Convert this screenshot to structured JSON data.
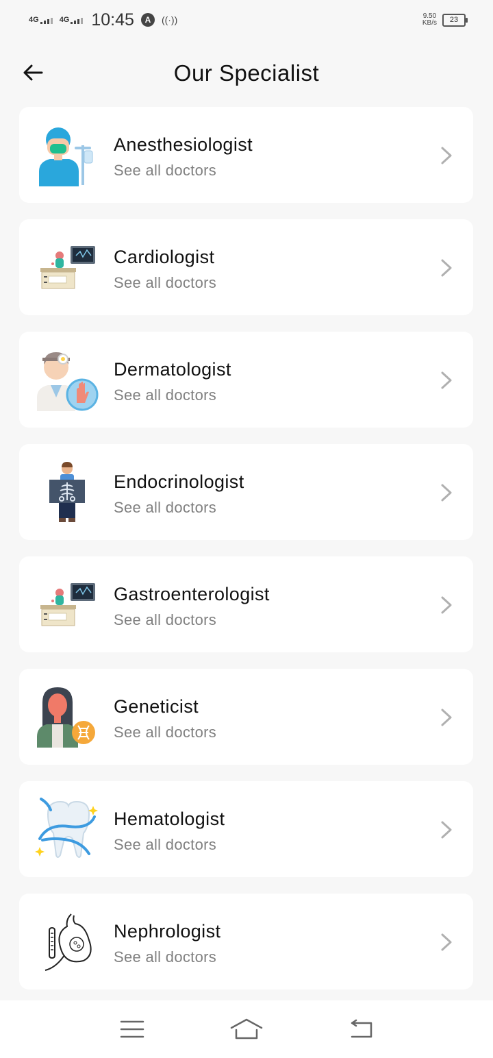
{
  "status_bar": {
    "net1": "4G",
    "net2": "4G",
    "time": "10:45",
    "alert_badge": "A",
    "speed_value": "9.50",
    "speed_unit": "KB/s",
    "battery": "23"
  },
  "header": {
    "title": "Our Specialist"
  },
  "specialists": [
    {
      "name": "Anesthesiologist",
      "subtitle": "See all doctors",
      "icon": "anesthesiologist-icon"
    },
    {
      "name": "Cardiologist",
      "subtitle": "See all doctors",
      "icon": "cardiologist-icon"
    },
    {
      "name": "Dermatologist",
      "subtitle": "See all doctors",
      "icon": "dermatologist-icon"
    },
    {
      "name": "Endocrinologist",
      "subtitle": "See all doctors",
      "icon": "endocrinologist-icon"
    },
    {
      "name": "Gastroenterologist",
      "subtitle": "See all doctors",
      "icon": "gastroenterologist-icon"
    },
    {
      "name": "Geneticist",
      "subtitle": "See all doctors",
      "icon": "geneticist-icon"
    },
    {
      "name": "Hematologist",
      "subtitle": "See all doctors",
      "icon": "hematologist-icon"
    },
    {
      "name": "Nephrologist",
      "subtitle": "See all doctors",
      "icon": "nephrologist-icon"
    }
  ],
  "nav": {
    "menu_icon": "menu-icon",
    "home_icon": "home-icon",
    "back_icon": "back-nav-icon"
  },
  "colors": {
    "background": "#f7f7f7",
    "card": "#ffffff",
    "subtitle": "#808080",
    "chevron": "#b0b0b0"
  }
}
